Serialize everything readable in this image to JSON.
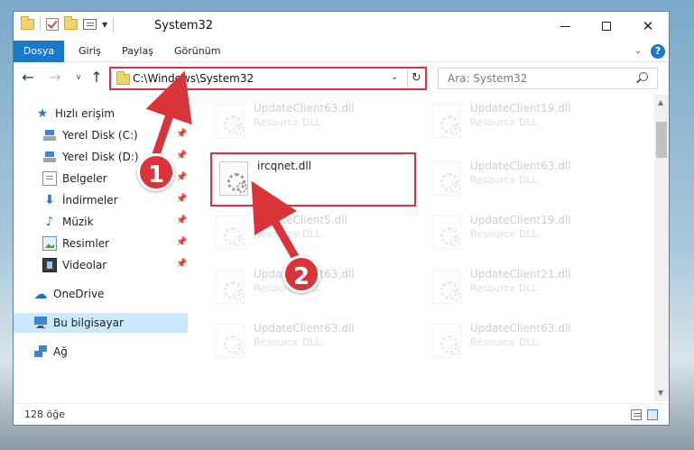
{
  "window": {
    "title": "System32"
  },
  "ribbon": {
    "tabs": [
      "Dosya",
      "Giriş",
      "Paylaş",
      "Görünüm"
    ],
    "help": "?"
  },
  "address": {
    "path": "C:\\Windows\\System32",
    "search_placeholder": "Ara: System32"
  },
  "sidebar": {
    "items": [
      {
        "label": "Hızlı erişim",
        "icon": "star-icon"
      },
      {
        "label": "Yerel Disk (C:)",
        "icon": "drive-icon",
        "pinned": true
      },
      {
        "label": "Yerel Disk (D:)",
        "icon": "drive-icon",
        "pinned": true
      },
      {
        "label": "Belgeler",
        "icon": "documents-icon",
        "pinned": true
      },
      {
        "label": "İndirmeler",
        "icon": "download-icon",
        "pinned": true
      },
      {
        "label": "Müzik",
        "icon": "music-icon",
        "pinned": true
      },
      {
        "label": "Resimler",
        "icon": "pictures-icon",
        "pinned": true
      },
      {
        "label": "Videolar",
        "icon": "videos-icon",
        "pinned": true
      },
      {
        "label": "OneDrive",
        "icon": "cloud-icon"
      },
      {
        "label": "Bu bilgisayar",
        "icon": "computer-icon",
        "selected": true
      },
      {
        "label": "Ağ",
        "icon": "network-icon"
      }
    ]
  },
  "files": {
    "highlighted": {
      "name": "ircqnet.dll"
    },
    "left": [
      {
        "name": "UpdateClient63.dll",
        "type": "Resource DLL"
      },
      {
        "name": "UpdateClient5.dll",
        "type": "Resource DLL"
      },
      {
        "name": "UpdateClient63.dll",
        "type": "Resource DLL"
      },
      {
        "name": "UpdateClient63.dll",
        "type": "Resource DLL"
      }
    ],
    "right": [
      {
        "name": "UpdateClient19.dll",
        "type": "Resource DLL"
      },
      {
        "name": "UpdateClient63.dll",
        "type": "Resource DLL"
      },
      {
        "name": "UpdateClient19.dll",
        "type": "Resource DLL"
      },
      {
        "name": "UpdateClient21.dll",
        "type": "Resource DLL"
      },
      {
        "name": "UpdateClient63.dll",
        "type": "Resource DLL"
      }
    ]
  },
  "status": {
    "count": "128 öğe"
  },
  "annotations": {
    "step1": "1",
    "step2": "2",
    "color": "#d8343a"
  }
}
